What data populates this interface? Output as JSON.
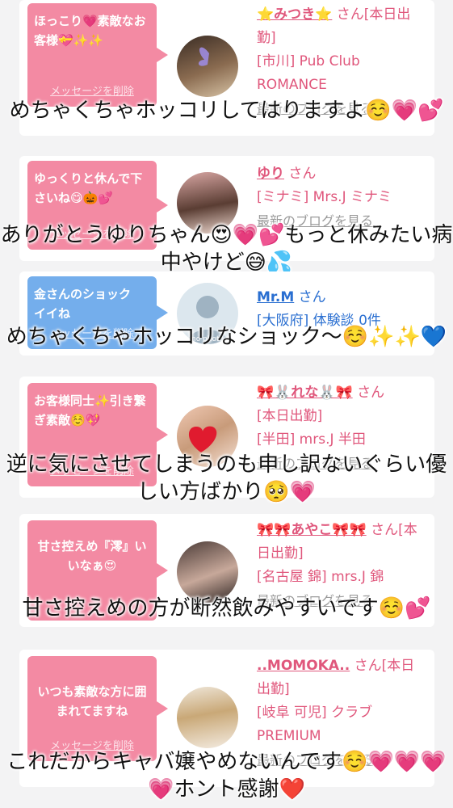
{
  "cards": [
    {
      "bubble_text": "ほっこり💗素敵なお客様💝✨✨",
      "delete_label": "メッセージを削除",
      "name": "⭐みつき⭐",
      "honorific": "さん[本日出勤]",
      "shop": "[市川] Pub Club ROMANCE",
      "blog": "最新のブログを見る",
      "caption": "めちゃくちゃホッコリしてはりますよ☺️💗💕"
    },
    {
      "bubble_text": "ゆっくりと休んで下さいね😋🎃💕",
      "delete_label": "メッセージを削除",
      "name": "ゆり",
      "honorific": "さん",
      "shop": "[ミナミ] Mrs.J ミナミ",
      "blog": "最新のブログを見る",
      "caption": "ありがとうゆりちゃん😍💗💕もっと休みたい病中やけど😅💦"
    },
    {
      "bubble_text": "金さんのショック　イイね",
      "delete_label": "メッセージを削除",
      "name": "Mr.M",
      "honorific": "さん",
      "shop": "[大阪府] 体験談 0件",
      "avatar_text": "no photo",
      "caption": "めちゃくちゃホッコリなショック〜☺️✨✨💙"
    },
    {
      "bubble_text": "お客様同士✨引き繋ぎ素敵☺️💖",
      "delete_label": "メッセージを削除",
      "name": "🎀🐰れな🐰🎀",
      "honorific": "さん",
      "status": "[本日出勤]",
      "shop": "[半田] mrs.J 半田",
      "blog": "最新のブログを見る",
      "caption": "逆に気にさせてしまうのも申し訳ないぐらい優しい方ばかり🥺💗"
    },
    {
      "bubble_text": "甘さ控えめ『澪』いいなぁ😍",
      "delete_label": "メッセージを削除",
      "name": "🎀🎀あやこ🎀🎀",
      "honorific": "さん[本日出勤]",
      "shop": "[名古屋 錦] mrs.J 錦",
      "blog": "最新のブログを見る",
      "caption": "甘さ控えめの方が断然飲みやすいです☺️💕"
    },
    {
      "bubble_text": "いつも素敵な方に囲まれてますね",
      "delete_label": "メッセージを削除",
      "name": "..MOMOKA..",
      "honorific": "さん[本日出勤]",
      "shop": "[岐阜 可児] クラブ PREMIUM",
      "blog": "最新のブログを見る",
      "caption": "これだからキャバ嬢やめないんです☺️💗💗💗💗ホント感謝❤️"
    }
  ],
  "colors": {
    "accent_pink": "#e0577c",
    "bubble_pink": "#f38aa3",
    "bubble_blue": "#74aeec",
    "link_blue": "#2a6fd1"
  }
}
